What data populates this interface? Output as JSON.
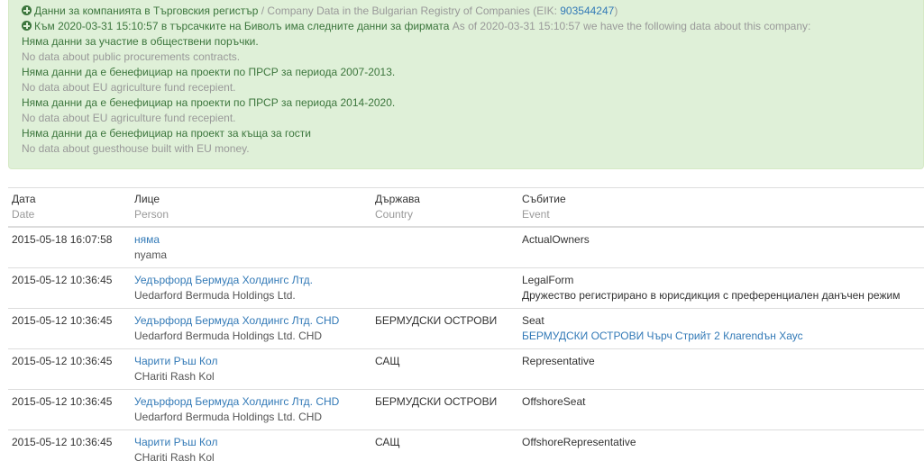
{
  "alert": {
    "line1": {
      "bg": "Данни за компанията в Търговския регистър",
      "sep": " / ",
      "en": "Company Data in the Bulgarian Registry of Companies",
      "eik_label": " (EIK: ",
      "eik": "903544247",
      "eik_close": ")"
    },
    "line2": {
      "bg": "Към 2020-03-31 15:10:57 в търсачките на Биволъ има следните данни за фирмата",
      "en": " As of 2020-03-31 15:10:57 we have the following data about this company:"
    },
    "items": [
      {
        "bg": "Няма данни за участие в обществени поръчки.",
        "en": "No data about public procurements contracts."
      },
      {
        "bg": "Няма данни да е бенефициар на проекти по ПРСР за периода 2007-2013.",
        "en": "No data about EU agriculture fund recepient."
      },
      {
        "bg": "Няма данни да е бенефициар на проекти по ПРСР за периода 2014-2020.",
        "en": "No data about EU agriculture fund recepient."
      },
      {
        "bg": "Няма данни да е бенефициар на проект за къща за гости",
        "en": "No data about guesthouse built with EU money."
      }
    ]
  },
  "table": {
    "headers": [
      {
        "bg": "Дата",
        "en": "Date"
      },
      {
        "bg": "Лице",
        "en": "Person"
      },
      {
        "bg": "Държава",
        "en": "Country"
      },
      {
        "bg": "Събитие",
        "en": "Event"
      }
    ],
    "rows": [
      {
        "date": "2015-05-18 16:07:58",
        "person": "няма",
        "person_en": "nyama",
        "country": "",
        "event": "ActualOwners",
        "event_detail": ""
      },
      {
        "date": "2015-05-12 10:36:45",
        "person": "Уедърфорд Бермуда Холдингс Лтд.",
        "person_en": "Uedarford Bermuda Holdings Ltd.",
        "country": "",
        "event": "LegalForm",
        "event_detail": "Дружество регистрирано в юрисдикция с преференциален данъчен режим"
      },
      {
        "date": "2015-05-12 10:36:45",
        "person": "Уедърфорд Бермуда Холдингс Лтд. CHD",
        "person_en": "Uedarford Bermuda Holdings Ltd. CHD",
        "country": "БЕРМУДСКИ ОСТРОВИ",
        "event": "Seat",
        "event_detail": "БЕРМУДСКИ ОСТРОВИ Чърч Стрийт 2 Клarendън Хаус"
      },
      {
        "date": "2015-05-12 10:36:45",
        "person": "Чарити Ръш Кол",
        "person_en": "CHariti Rash Kol",
        "country": "САЩ",
        "event": "Representative",
        "event_detail": ""
      },
      {
        "date": "2015-05-12 10:36:45",
        "person": "Уедърфорд Бермуда Холдингс Лтд. CHD",
        "person_en": "Uedarford Bermuda Holdings Ltd. CHD",
        "country": "БЕРМУДСКИ ОСТРОВИ",
        "event": "OffshoreSeat",
        "event_detail": ""
      },
      {
        "date": "2015-05-12 10:36:45",
        "person": "Чарити Ръш Кол",
        "person_en": "CHariti Rash Kol",
        "country": "САЩ",
        "event": "OffshoreRepresentative",
        "event_detail": ""
      }
    ]
  },
  "icons": {
    "expand": "plus-circle-icon"
  },
  "colors": {
    "link": "#337ab7",
    "alert_bg": "#dff0d8",
    "alert_text": "#3c763d",
    "muted": "#999999"
  }
}
